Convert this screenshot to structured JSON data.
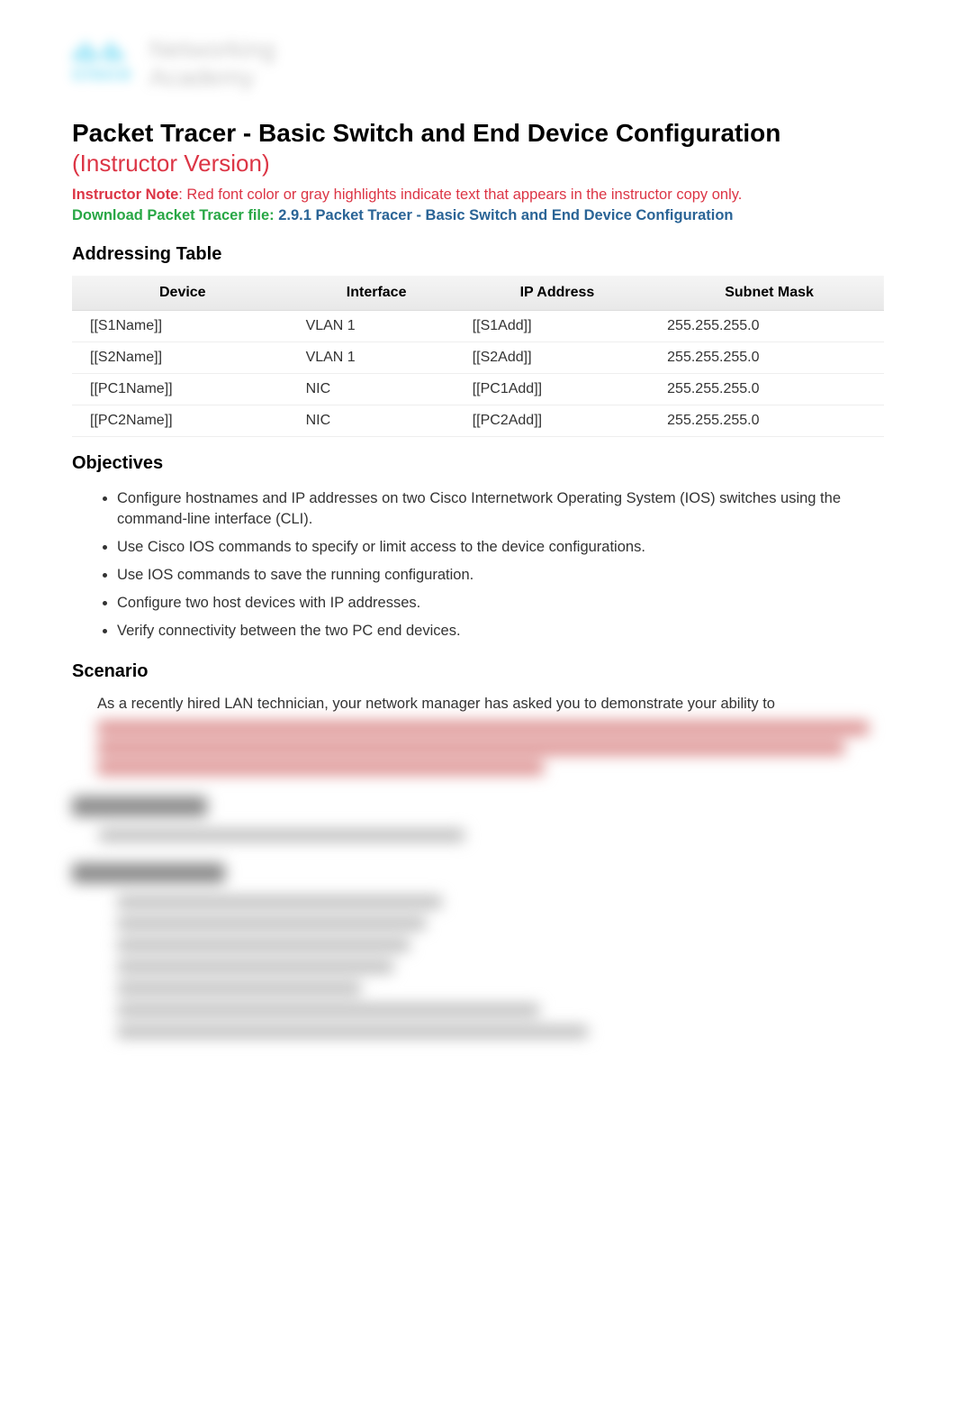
{
  "logo": {
    "brand": "cisco",
    "product1": "Networking",
    "product2": "Academy"
  },
  "title": "Packet Tracer - Basic Switch and End Device Configuration",
  "subtitle": "(Instructor Version)",
  "instructor_note": {
    "label": "Instructor Note",
    "text": ": Red font color or gray highlights indicate text that appears in the instructor copy only."
  },
  "download": {
    "label": "Download Packet Tracer file: ",
    "link_text": "2.9.1 Packet Tracer - Basic Switch and End Device Configuration"
  },
  "sections": {
    "addressing": "Addressing Table",
    "objectives": "Objectives",
    "scenario": "Scenario"
  },
  "table": {
    "headers": [
      "Device",
      "Interface",
      "IP Address",
      "Subnet Mask"
    ],
    "rows": [
      {
        "device": "[[S1Name]]",
        "iface": "VLAN 1",
        "ip": "[[S1Add]]",
        "mask": "255.255.255.0"
      },
      {
        "device": "[[S2Name]]",
        "iface": "VLAN 1",
        "ip": "[[S2Add]]",
        "mask": "255.255.255.0"
      },
      {
        "device": "[[PC1Name]]",
        "iface": "NIC",
        "ip": "[[PC1Add]]",
        "mask": "255.255.255.0"
      },
      {
        "device": "[[PC2Name]]",
        "iface": "NIC",
        "ip": "[[PC2Add]]",
        "mask": "255.255.255.0"
      }
    ]
  },
  "objectives": [
    "Configure hostnames and IP addresses on two Cisco Internetwork Operating System (IOS) switches using the command-line interface (CLI).",
    "Use Cisco IOS commands to specify or limit access to the device configurations.",
    "Use IOS commands to save the running configuration.",
    "Configure two host devices with IP addresses.",
    "Verify connectivity between the two PC end devices."
  ],
  "scenario_text": "As a recently hired LAN technician, your network manager has asked you to demonstrate your ability to"
}
